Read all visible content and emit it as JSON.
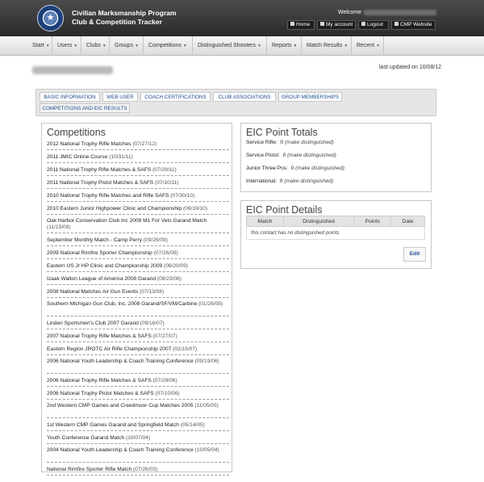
{
  "header": {
    "app_title_line1": "Civilian Marksmanship Program",
    "app_title_line2": "Club & Competition Tracker",
    "welcome_label": "Welcome",
    "seal_icon": "cmp-seal-icon",
    "buttons": [
      {
        "label": "Home",
        "icon": "home-icon"
      },
      {
        "label": "My account",
        "icon": "user-icon"
      },
      {
        "label": "Logout",
        "icon": "logout-icon"
      },
      {
        "label": "CMP Website",
        "icon": "globe-icon"
      }
    ]
  },
  "nav": {
    "items": [
      {
        "label": "Start"
      },
      {
        "label": "Users"
      },
      {
        "label": "Clubs"
      },
      {
        "label": "Groups"
      },
      {
        "label": "Competitions"
      },
      {
        "label": "Distinguished Shooters"
      },
      {
        "label": "Reports"
      },
      {
        "label": "Match Results"
      },
      {
        "label": "Recent"
      }
    ]
  },
  "contact": {
    "last_updated": "last updated on 10/08/12"
  },
  "tabs": [
    {
      "label": "Basic Information",
      "active": false
    },
    {
      "label": "Web User",
      "active": false
    },
    {
      "label": "Coach Certifications",
      "active": false
    },
    {
      "label": "Club Associations",
      "active": false
    },
    {
      "label": "Group Memberships",
      "active": false
    },
    {
      "label": "Competitions and EIC Results",
      "active": true
    }
  ],
  "competitions": {
    "title": "Competitions",
    "items": [
      {
        "name": "2012 National Trophy Rifle Matches",
        "date": "(07/27/12)"
      },
      {
        "name": "2011 JMIC Online Course",
        "date": "(10/31/11)"
      },
      {
        "name": "2011 National Trophy Rifle Matches & SAFS",
        "date": "(07/29/11)"
      },
      {
        "name": "2011 National Trophy Pistol Matches & SAFS",
        "date": "(07/10/11)"
      },
      {
        "name": "2010 National Trophy Rifle Matches and Rifle SAFS",
        "date": "(07/30/10)"
      },
      {
        "name": "2010 Eastern Junior Highpower Clinic and Championship",
        "date": "(06/19/10)"
      },
      {
        "name": "Oak Harbor Conservation Club Inc 2009 M1 For Vets Garand Match",
        "date": "(11/15/09)"
      },
      {
        "name": "September Monthly Match - Camp Perry",
        "date": "(09/26/09)"
      },
      {
        "name": "2009 National Rimfire Sporter Championship",
        "date": "(07/26/09)"
      },
      {
        "name": "Eastern US Jr HP Clinic and Championship 2009",
        "date": "(06/20/09)"
      },
      {
        "name": "Izaak Walton League of America 2008 Garand",
        "date": "(08/23/08)"
      },
      {
        "name": "2008 National Matches Air Gun Events",
        "date": "(07/13/08)"
      },
      {
        "name": "Southern Michigan Gun Club, Inc. 2008 Garand/SF/VM/Carbine",
        "date": "(01/26/08)"
      },
      {
        "name": "Linden Sportsmen's Club 2007 Garand",
        "date": "(09/16/07)"
      },
      {
        "name": "2007 National Trophy Rifle Matches & SAFS",
        "date": "(07/27/07)"
      },
      {
        "name": "Eastern Region JROTC Air Rifle Championship 2007",
        "date": "(02/15/07)"
      },
      {
        "name": "2006 National Youth Leadership & Coach Training Conference",
        "date": "(09/19/06)"
      },
      {
        "name": "2006 National Trophy Rifle Matches & SAFS",
        "date": "(07/29/06)"
      },
      {
        "name": "2006 National Trophy Pistol Matches & SAFS",
        "date": "(07/10/06)"
      },
      {
        "name": "2nd Western CMP Games and Creedmoor Cup Matches 2005",
        "date": "(11/05/05)"
      },
      {
        "name": "1st Western CMP Games Garand and Springfield Match",
        "date": "(05/14/05)"
      },
      {
        "name": "Youth Conference Garand Match",
        "date": "(10/07/04)"
      },
      {
        "name": "2004 National Youth Leadership & Coach Training Conference",
        "date": "(10/05/04)"
      },
      {
        "name": "National Rimfire Sporter Rifle Match",
        "date": "(07/26/03)"
      }
    ]
  },
  "eic_totals": {
    "title": "EIC Point Totals",
    "rows": [
      {
        "label": "Service Rifle:",
        "value": "0",
        "note": "(make distinguished)"
      },
      {
        "label": "Service Pistol:",
        "value": "0",
        "note": "(make distinguished)"
      },
      {
        "label": "Junior Three Pos:",
        "value": "0",
        "note": "(make distinguished)"
      },
      {
        "label": "International:",
        "value": "0",
        "note": "(make distinguished)"
      }
    ]
  },
  "eic_details": {
    "title": "EIC Point Details",
    "columns": [
      "Match",
      "Distinguished",
      "Points",
      "Date"
    ],
    "empty_message": "this contact has no distinguished points",
    "edit_label": "Edit"
  }
}
